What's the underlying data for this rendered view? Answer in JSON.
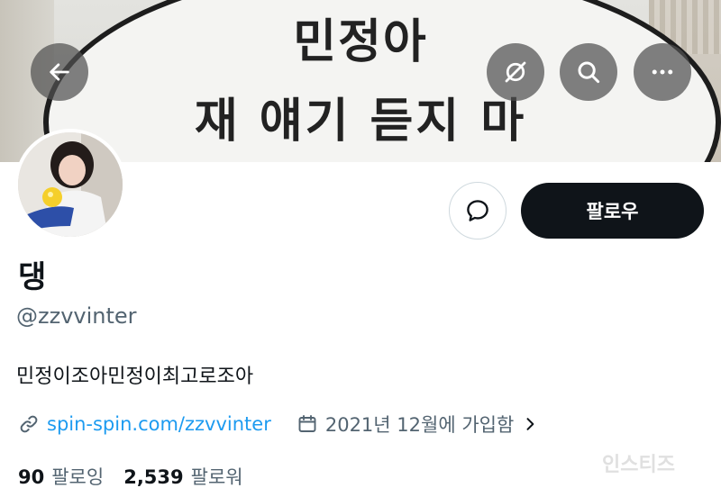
{
  "banner": {
    "line1": "민정아",
    "line2": "재 얘기 듣지 마"
  },
  "header": {
    "back_icon": "arrow-left-icon",
    "grok_icon": "slashed-circle-icon",
    "search_icon": "search-icon",
    "more_icon": "more-horizontal-icon"
  },
  "profile": {
    "name": "댕",
    "handle": "@zzvvinter",
    "bio": "민정이조아민정이최고로조아",
    "website": "spin-spin.com/zzvvinter",
    "joined": "2021년 12월에 가입함",
    "following_count": "90",
    "following_label": "팔로잉",
    "followers_count": "2,539",
    "followers_label": "팔로워"
  },
  "actions": {
    "follow_label": "팔로우",
    "message_icon": "message-bubble-icon"
  },
  "watermark": "인스티즈",
  "colors": {
    "link": "#1d9bf0",
    "muted": "#536471",
    "primary": "#0f1419",
    "button_border": "#cfd9de"
  }
}
